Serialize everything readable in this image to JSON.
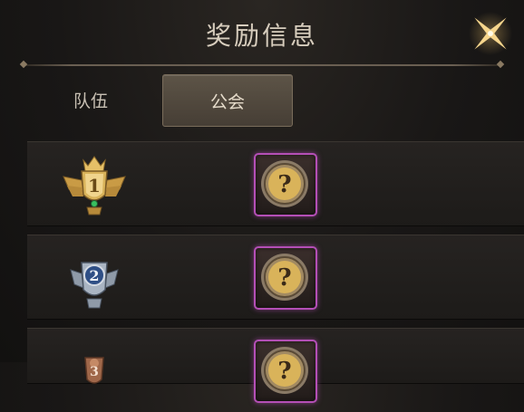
{
  "header": {
    "title": "奖励信息"
  },
  "tabs": [
    {
      "label": "队伍"
    },
    {
      "label": "公会"
    }
  ],
  "rows": [
    {
      "rank": "1",
      "reward_glyph": "?"
    },
    {
      "rank": "2",
      "reward_glyph": "?"
    },
    {
      "rank": "3",
      "reward_glyph": "?"
    }
  ],
  "icons": {
    "close": "star-sparkle-close-icon",
    "rank1": "gold-trophy-icon",
    "rank2": "silver-trophy-icon",
    "rank3": "bronze-trophy-icon",
    "reward": "mystery-reward-icon"
  },
  "colors": {
    "gold": "#d9b35a",
    "silver": "#a9b4c2",
    "bronze": "#a0684a",
    "reward_border": "#b44fb6"
  }
}
